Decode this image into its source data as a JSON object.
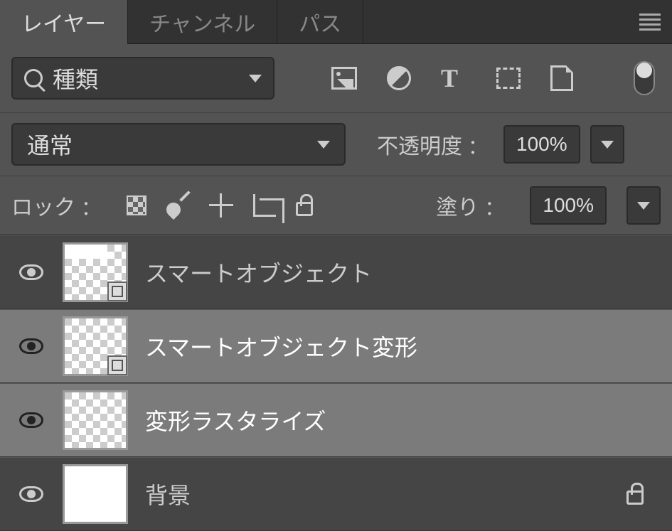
{
  "tabs": {
    "layers": "レイヤー",
    "channels": "チャンネル",
    "paths": "パス"
  },
  "filter": {
    "label": "種類"
  },
  "blend": {
    "mode": "通常",
    "opacity_label": "不透明度",
    "opacity_value": "100%"
  },
  "lock": {
    "label": "ロック",
    "fill_label": "塗り",
    "fill_value": "100%"
  },
  "layers": [
    {
      "name": "スマートオブジェクト",
      "smart": true,
      "selected": false,
      "locked": false
    },
    {
      "name": "スマートオブジェクト変形",
      "smart": true,
      "selected": true,
      "locked": false
    },
    {
      "name": "変形ラスタライズ",
      "smart": false,
      "selected": true,
      "locked": false
    },
    {
      "name": "背景",
      "smart": false,
      "selected": false,
      "locked": true
    }
  ],
  "colon": "："
}
